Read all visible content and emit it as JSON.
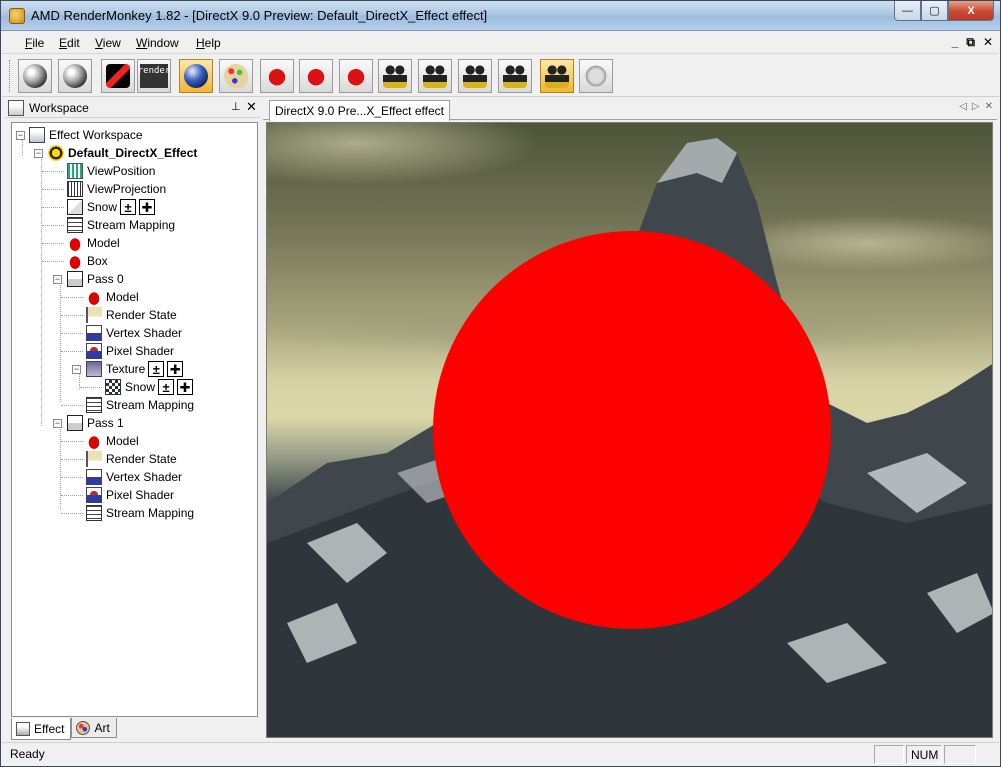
{
  "window": {
    "title": "AMD RenderMonkey 1.82 - [DirectX 9.0 Preview: Default_DirectX_Effect effect]",
    "controls": {
      "minimize": "—",
      "maximize": "▢",
      "close": "X"
    }
  },
  "menu": {
    "items": [
      {
        "label": "File",
        "accel": "F",
        "rest": "ile"
      },
      {
        "label": "Edit",
        "accel": "E",
        "rest": "dit"
      },
      {
        "label": "View",
        "accel": "V",
        "rest": "iew"
      },
      {
        "label": "Window",
        "accel": "W",
        "rest": "indow"
      },
      {
        "label": "Help",
        "accel": "H",
        "rest": "elp"
      }
    ],
    "mdi_controls": {
      "minimize": "_",
      "restore": "⧉",
      "close": "✕"
    }
  },
  "toolbar": {
    "buttons": [
      {
        "icon": "ati-sphere-icon"
      },
      {
        "icon": "ati-sphere-icon"
      },
      {
        "icon": "pencil-icon"
      },
      {
        "icon": "render-icon",
        "text": "render"
      },
      {
        "icon": "blue-sphere-icon",
        "active": true
      },
      {
        "icon": "palette-icon"
      },
      {
        "icon": "apple-icon"
      },
      {
        "icon": "apple-gl-icon"
      },
      {
        "icon": "apple-doc-icon"
      },
      {
        "icon": "camera-icon"
      },
      {
        "icon": "camera-icon"
      },
      {
        "icon": "camera-icon"
      },
      {
        "icon": "camera-icon"
      },
      {
        "icon": "camera-icon",
        "active": true
      },
      {
        "icon": "mouse-icon"
      }
    ]
  },
  "workspace": {
    "title": "Workspace",
    "pin": "⊥",
    "close": "✕",
    "tree": {
      "root": "Effect Workspace",
      "effect": "Default_DirectX_Effect",
      "items": [
        "ViewPosition",
        "ViewProjection",
        "Snow",
        "Stream Mapping",
        "Model",
        "Box",
        "Pass 0",
        "Model",
        "Render State",
        "Vertex Shader",
        "Pixel Shader",
        "Texture",
        "Snow",
        "Stream Mapping",
        "Pass 1",
        "Model",
        "Render State",
        "Vertex Shader",
        "Pixel Shader",
        "Stream Mapping"
      ]
    },
    "tabs": {
      "effect": "Effect",
      "art": "Art"
    }
  },
  "document": {
    "tab_label": "DirectX 9.0 Pre...X_Effect effect",
    "nav_prev": "◁",
    "nav_next": "▷",
    "nav_close": "✕",
    "sphere_color": "#ff0000"
  },
  "statusbar": {
    "message": "Ready",
    "num": "NUM"
  }
}
